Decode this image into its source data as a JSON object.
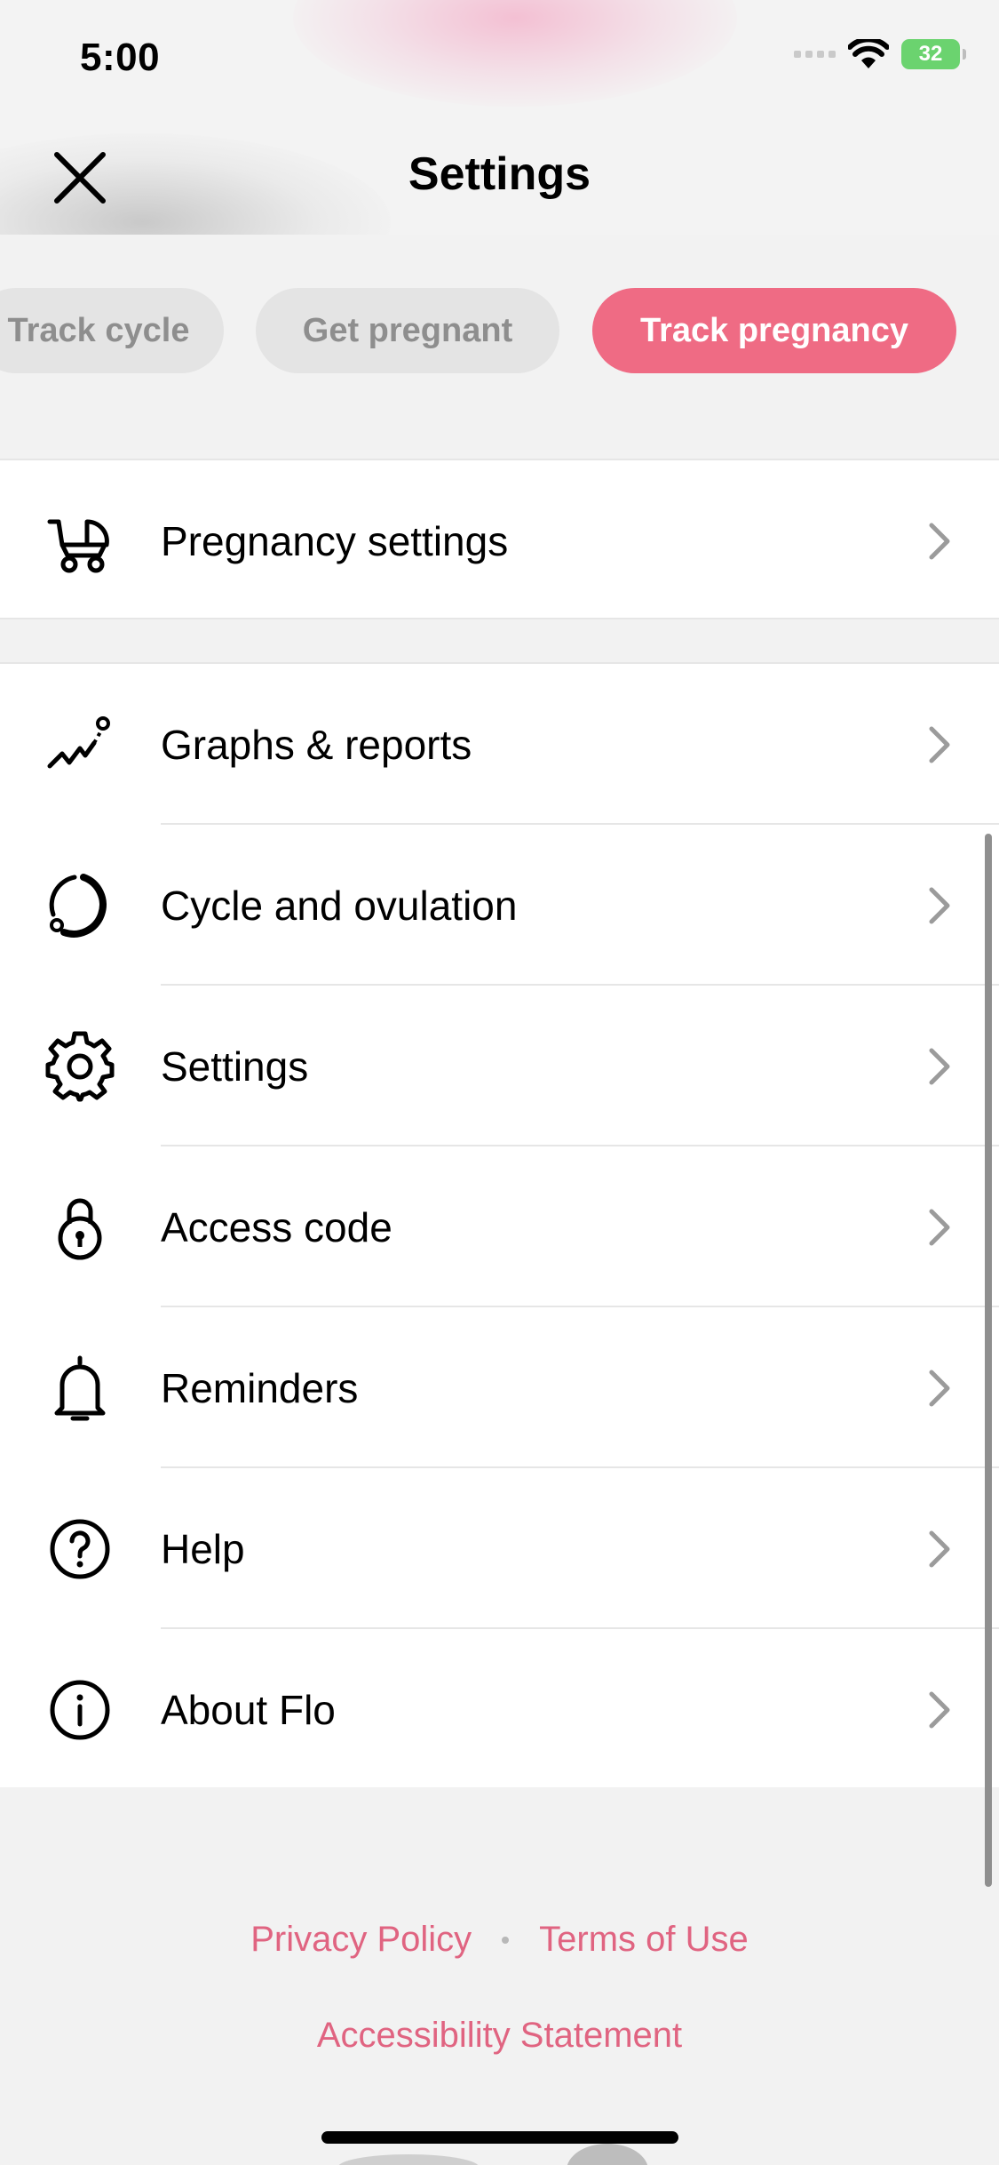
{
  "status_bar": {
    "time": "5:00",
    "battery": "32"
  },
  "nav": {
    "title": "Settings"
  },
  "goals": {
    "items": [
      "Track cycle",
      "Get pregnant",
      "Track pregnancy"
    ],
    "active_index": 2,
    "active_color": "#ef6b84"
  },
  "sections": {
    "pregnancy": {
      "label": "Pregnancy settings",
      "icon": "stroller-icon"
    },
    "menu": [
      {
        "label": "Graphs & reports",
        "icon": "graph-icon"
      },
      {
        "label": "Cycle and ovulation",
        "icon": "cycle-icon"
      },
      {
        "label": "Settings",
        "icon": "gear-icon"
      },
      {
        "label": "Access code",
        "icon": "lock-icon"
      },
      {
        "label": "Reminders",
        "icon": "bell-icon"
      },
      {
        "label": "Help",
        "icon": "help-icon"
      },
      {
        "label": "About Flo",
        "icon": "info-icon"
      }
    ]
  },
  "footer": {
    "privacy": "Privacy Policy",
    "terms": "Terms of Use",
    "accessibility": "Accessibility Statement",
    "link_color": "#e06481"
  }
}
